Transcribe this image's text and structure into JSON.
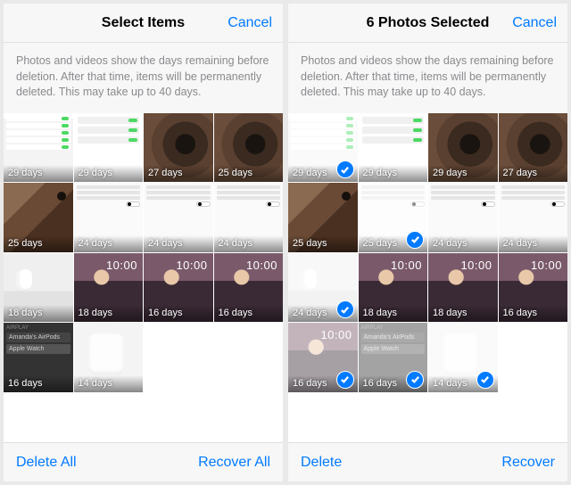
{
  "left": {
    "title": "Select Items",
    "cancel": "Cancel",
    "info": "Photos and videos show the days remaining before deletion. After that time, items will be permanently deleted. This may take up to 40 days.",
    "toolbar": {
      "left": "Delete All",
      "right": "Recover All"
    },
    "photos": [
      {
        "days": "29 days",
        "kind": "settings",
        "selected": false
      },
      {
        "days": "29 days",
        "kind": "toggles",
        "selected": false
      },
      {
        "days": "27 days",
        "kind": "eye",
        "selected": false
      },
      {
        "days": "25 days",
        "kind": "eye",
        "selected": false
      },
      {
        "days": "25 days",
        "kind": "dog",
        "selected": false
      },
      {
        "days": "24 days",
        "kind": "screenshot",
        "selected": false
      },
      {
        "days": "24 days",
        "kind": "screenshot",
        "selected": false
      },
      {
        "days": "24 days",
        "kind": "screenshot",
        "selected": false
      },
      {
        "days": "18 days",
        "kind": "earbuds",
        "selected": false,
        "clock": ""
      },
      {
        "days": "18 days",
        "kind": "tree",
        "selected": false,
        "clock": "10:00"
      },
      {
        "days": "16 days",
        "kind": "tree",
        "selected": false,
        "clock": "10:00"
      },
      {
        "days": "16 days",
        "kind": "tree",
        "selected": false,
        "clock": "10:00"
      },
      {
        "days": "16 days",
        "kind": "airplay",
        "selected": false,
        "airplay": {
          "header": "AIRPLAY",
          "opt1": "Amanda's AirPods",
          "opt2": "Apple Watch"
        }
      },
      {
        "days": "14 days",
        "kind": "case",
        "selected": false
      }
    ]
  },
  "right": {
    "title": "6 Photos Selected",
    "cancel": "Cancel",
    "info": "Photos and videos show the days remaining before deletion. After that time, items will be permanently deleted. This may take up to 40 days.",
    "toolbar": {
      "left": "Delete",
      "right": "Recover"
    },
    "photos": [
      {
        "days": "29 days",
        "kind": "settings",
        "selected": true
      },
      {
        "days": "29 days",
        "kind": "toggles",
        "selected": false
      },
      {
        "days": "29 days",
        "kind": "eye",
        "selected": false
      },
      {
        "days": "27 days",
        "kind": "eye",
        "selected": false
      },
      {
        "days": "25 days",
        "kind": "dog",
        "selected": false
      },
      {
        "days": "25 days",
        "kind": "screenshot",
        "selected": true
      },
      {
        "days": "24 days",
        "kind": "screenshot",
        "selected": false
      },
      {
        "days": "24 days",
        "kind": "screenshot",
        "selected": false
      },
      {
        "days": "24 days",
        "kind": "earbuds",
        "selected": true
      },
      {
        "days": "18 days",
        "kind": "tree",
        "selected": false,
        "clock": "10:00"
      },
      {
        "days": "18 days",
        "kind": "tree",
        "selected": false,
        "clock": "10:00"
      },
      {
        "days": "16 days",
        "kind": "tree",
        "selected": false,
        "clock": "10:00"
      },
      {
        "days": "16 days",
        "kind": "tree",
        "selected": true,
        "clock": "10:00"
      },
      {
        "days": "16 days",
        "kind": "airplay",
        "selected": true,
        "airplay": {
          "header": "AIRPLAY",
          "opt1": "Amanda's AirPods",
          "opt2": "Apple Watch"
        }
      },
      {
        "days": "14 days",
        "kind": "case",
        "selected": true
      }
    ]
  }
}
